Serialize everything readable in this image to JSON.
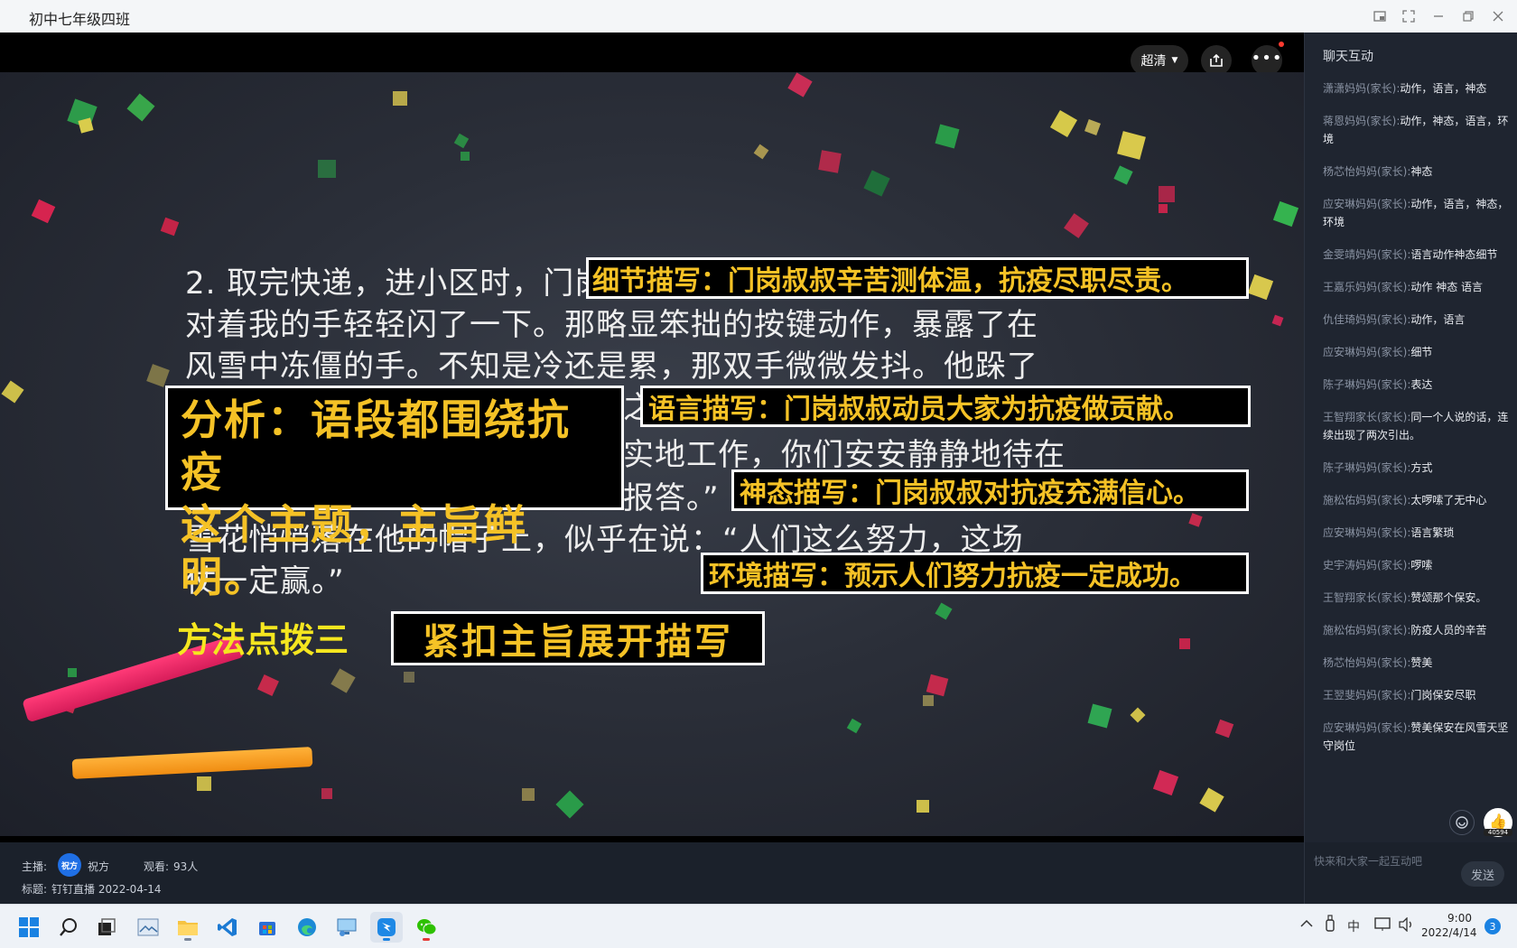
{
  "window": {
    "title": "初中七年级四班"
  },
  "player": {
    "quality_label": "超清"
  },
  "slide": {
    "paragraph_lines": [
      "2. 取完快递，进小区时，门岗",
      "对着我的手轻轻闪了一下。那略显笨拙的按键动作，暴露了在",
      "风雪中冻僵的手。不知是冷还是累，那双手微微发抖。他跺了",
      "实地工作，你们安安静静地待在",
      "报答。”",
      "雪花悄悄落在他的帽子上，似乎在说：“人们这么努力，这场",
      "仗一定赢。”"
    ],
    "fragment_zhi": "之",
    "annotations": [
      "细节描写：门岗叔叔辛苦测体温，抗疫尽职尽责。",
      "语言描写：门岗叔叔动员大家为抗疫做贡献。",
      "神态描写：门岗叔叔对抗疫充满信心。",
      "环境描写：预示人们努力抗疫一定成功。"
    ],
    "analysis_lines": [
      "分析：语段都围绕抗疫",
      "这个主题，主旨鲜明。"
    ],
    "method_label": "方法点拨三",
    "method_theme": "紧扣主旨展开描写"
  },
  "chat": {
    "title": "聊天互动",
    "messages": [
      {
        "who": "潇潇妈妈(家长):",
        "text": "动作，语言，神态"
      },
      {
        "who": "蒋恩妈妈(家长):",
        "text": "动作，神态，语言，环境"
      },
      {
        "who": "杨芯怡妈妈(家长):",
        "text": "神态"
      },
      {
        "who": "应安琳妈妈(家长):",
        "text": "动作，语言，神态，环境"
      },
      {
        "who": "金雯靖妈妈(家长):",
        "text": "语言动作神态细节"
      },
      {
        "who": "王嘉乐妈妈(家长):",
        "text": "动作 神态 语言"
      },
      {
        "who": "仇佳琦妈妈(家长):",
        "text": "动作，语言"
      },
      {
        "who": "应安琳妈妈(家长):",
        "text": "细节"
      },
      {
        "who": "陈子琳妈妈(家长):",
        "text": "表达"
      },
      {
        "who": "王智翔家长(家长):",
        "text": "同一个人说的话，连续出现了两次引出。"
      },
      {
        "who": "陈子琳妈妈(家长):",
        "text": "方式"
      },
      {
        "who": "施松佑妈妈(家长):",
        "text": "太啰嗦了无中心"
      },
      {
        "who": "应安琳妈妈(家长):",
        "text": "语言繁琐"
      },
      {
        "who": "史宇涛妈妈(家长):",
        "text": "啰嗦"
      },
      {
        "who": "王智翔家长(家长):",
        "text": "赞颂那个保安。"
      },
      {
        "who": "施松佑妈妈(家长):",
        "text": "防疫人员的辛苦"
      },
      {
        "who": "杨芯怡妈妈(家长):",
        "text": "赞美"
      },
      {
        "who": "王翌斐妈妈(家长):",
        "text": "门岗保安尽职"
      },
      {
        "who": "应安琳妈妈(家长):",
        "text": "赞美保安在风雪天坚守岗位"
      }
    ],
    "like_count": "40594",
    "input_placeholder": "快来和大家一起互动吧",
    "send_label": "发送"
  },
  "info": {
    "host_label": "主播:",
    "host_avatar_text": "祝方",
    "host_name": "祝方",
    "viewers_label": "观看:",
    "viewers_value": "93人",
    "title_label": "标题:",
    "title_value": "钉钉直播 2022-04-14"
  },
  "taskbar": {
    "ime": "中",
    "time": "9:00",
    "date": "2022/4/14",
    "notification_count": "3"
  }
}
